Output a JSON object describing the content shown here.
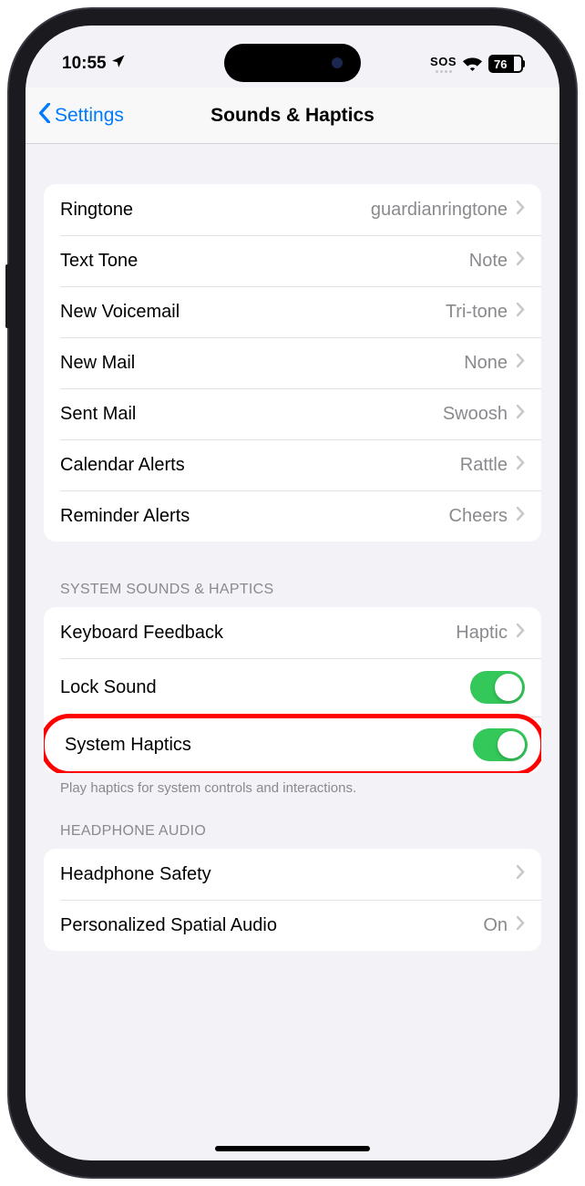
{
  "status": {
    "time": "10:55",
    "sos": "SOS",
    "battery": "76"
  },
  "nav": {
    "back_label": "Settings",
    "title": "Sounds & Haptics"
  },
  "sounds": {
    "rows": [
      {
        "label": "Ringtone",
        "value": "guardianringtone"
      },
      {
        "label": "Text Tone",
        "value": "Note"
      },
      {
        "label": "New Voicemail",
        "value": "Tri-tone"
      },
      {
        "label": "New Mail",
        "value": "None"
      },
      {
        "label": "Sent Mail",
        "value": "Swoosh"
      },
      {
        "label": "Calendar Alerts",
        "value": "Rattle"
      },
      {
        "label": "Reminder Alerts",
        "value": "Cheers"
      }
    ]
  },
  "system": {
    "header": "SYSTEM SOUNDS & HAPTICS",
    "keyboard": {
      "label": "Keyboard Feedback",
      "value": "Haptic"
    },
    "lock": {
      "label": "Lock Sound"
    },
    "haptics": {
      "label": "System Haptics"
    },
    "footer": "Play haptics for system controls and interactions."
  },
  "headphone": {
    "header": "HEADPHONE AUDIO",
    "safety": {
      "label": "Headphone Safety"
    },
    "spatial": {
      "label": "Personalized Spatial Audio",
      "value": "On"
    }
  }
}
